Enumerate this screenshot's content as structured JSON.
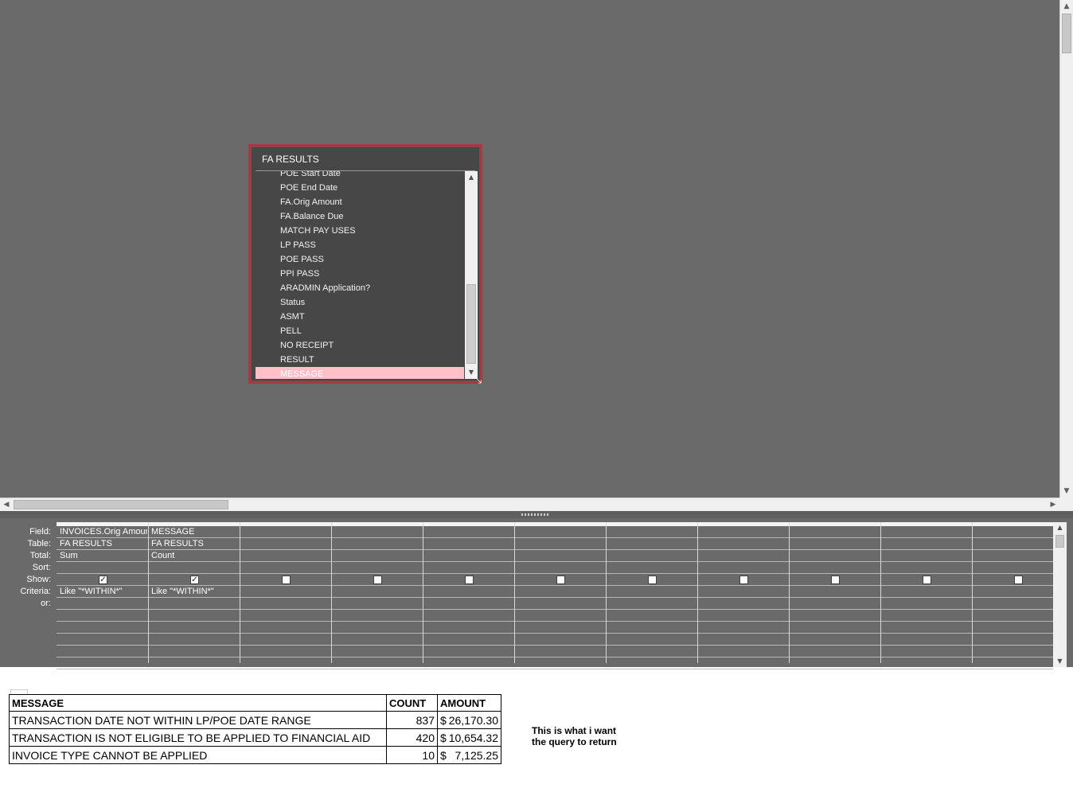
{
  "field_list": {
    "title": "FA RESULTS",
    "items": [
      {
        "label": "POE Start Date",
        "selected": false
      },
      {
        "label": "POE End Date",
        "selected": false
      },
      {
        "label": "FA.Orig Amount",
        "selected": false
      },
      {
        "label": "FA.Balance Due",
        "selected": false
      },
      {
        "label": "MATCH PAY USES",
        "selected": false
      },
      {
        "label": "LP PASS",
        "selected": false
      },
      {
        "label": "POE PASS",
        "selected": false
      },
      {
        "label": "PPI PASS",
        "selected": false
      },
      {
        "label": "ARADMIN Application?",
        "selected": false
      },
      {
        "label": "Status",
        "selected": false
      },
      {
        "label": "ASMT",
        "selected": false
      },
      {
        "label": "PELL",
        "selected": false
      },
      {
        "label": "NO RECEIPT",
        "selected": false
      },
      {
        "label": "RESULT",
        "selected": false
      },
      {
        "label": "MESSAGE",
        "selected": true
      }
    ]
  },
  "query_grid": {
    "row_labels": [
      "Field:",
      "Table:",
      "Total:",
      "Sort:",
      "Show:",
      "Criteria:",
      "or:"
    ],
    "columns": [
      {
        "field": "INVOICES.Orig Amour",
        "table": "FA RESULTS",
        "total": "Sum",
        "sort": "",
        "show": true,
        "criteria": "Like \"*WITHIN*\""
      },
      {
        "field": "MESSAGE",
        "table": "FA RESULTS",
        "total": "Count",
        "sort": "",
        "show": true,
        "criteria": "Like \"*WITHIN*\""
      },
      {
        "field": "",
        "table": "",
        "total": "",
        "sort": "",
        "show": false,
        "criteria": ""
      },
      {
        "field": "",
        "table": "",
        "total": "",
        "sort": "",
        "show": false,
        "criteria": ""
      },
      {
        "field": "",
        "table": "",
        "total": "",
        "sort": "",
        "show": false,
        "criteria": ""
      },
      {
        "field": "",
        "table": "",
        "total": "",
        "sort": "",
        "show": false,
        "criteria": ""
      },
      {
        "field": "",
        "table": "",
        "total": "",
        "sort": "",
        "show": false,
        "criteria": ""
      },
      {
        "field": "",
        "table": "",
        "total": "",
        "sort": "",
        "show": false,
        "criteria": ""
      },
      {
        "field": "",
        "table": "",
        "total": "",
        "sort": "",
        "show": false,
        "criteria": ""
      },
      {
        "field": "",
        "table": "",
        "total": "",
        "sort": "",
        "show": false,
        "criteria": ""
      },
      {
        "field": "",
        "table": "",
        "total": "",
        "sort": "",
        "show": false,
        "criteria": ""
      }
    ]
  },
  "result_table": {
    "headers": [
      "MESSAGE",
      "COUNT",
      "AMOUNT"
    ],
    "rows": [
      {
        "message": "TRANSACTION DATE NOT WITHIN LP/POE DATE RANGE",
        "count": "837",
        "currency": "$",
        "amount": "26,170.30"
      },
      {
        "message": "TRANSACTION IS NOT ELIGIBLE TO BE APPLIED TO FINANCIAL AID",
        "count": "420",
        "currency": "$",
        "amount": "10,654.32"
      },
      {
        "message": "INVOICE TYPE CANNOT BE APPLIED",
        "count": "10",
        "currency": "$",
        "amount": "7,125.25"
      }
    ]
  },
  "note": {
    "line1": "This is what i want",
    "line2": "the query to return"
  },
  "icons": {
    "scroll_up": "arrow-up-icon",
    "scroll_down": "arrow-down-icon",
    "scroll_left": "arrow-left-icon",
    "scroll_right": "arrow-right-icon",
    "checkbox_checked": "check-icon",
    "resize_cursor": "resize-cursor-icon"
  },
  "colors": {
    "design_bg": "#6a6a6a",
    "field_list_border": "#a43b43",
    "field_list_bg": "#474747",
    "selected_item_bg": "#ffc0c8"
  }
}
